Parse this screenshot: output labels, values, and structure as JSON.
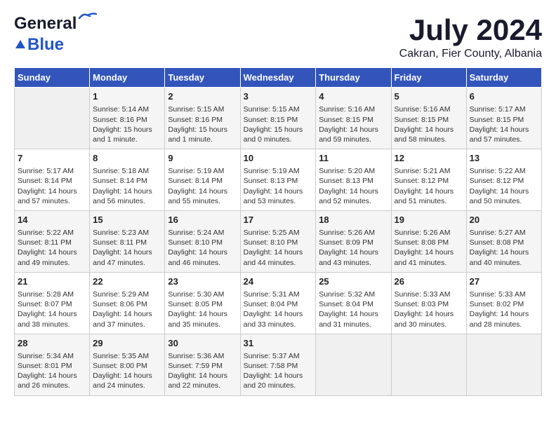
{
  "header": {
    "logo_line1": "General",
    "logo_line2": "Blue",
    "month": "July 2024",
    "location": "Cakran, Fier County, Albania"
  },
  "days_of_week": [
    "Sunday",
    "Monday",
    "Tuesday",
    "Wednesday",
    "Thursday",
    "Friday",
    "Saturday"
  ],
  "weeks": [
    [
      {
        "day": "",
        "content": ""
      },
      {
        "day": "1",
        "content": "Sunrise: 5:14 AM\nSunset: 8:16 PM\nDaylight: 15 hours\nand 1 minute."
      },
      {
        "day": "2",
        "content": "Sunrise: 5:15 AM\nSunset: 8:16 PM\nDaylight: 15 hours\nand 1 minute."
      },
      {
        "day": "3",
        "content": "Sunrise: 5:15 AM\nSunset: 8:15 PM\nDaylight: 15 hours\nand 0 minutes."
      },
      {
        "day": "4",
        "content": "Sunrise: 5:16 AM\nSunset: 8:15 PM\nDaylight: 14 hours\nand 59 minutes."
      },
      {
        "day": "5",
        "content": "Sunrise: 5:16 AM\nSunset: 8:15 PM\nDaylight: 14 hours\nand 58 minutes."
      },
      {
        "day": "6",
        "content": "Sunrise: 5:17 AM\nSunset: 8:15 PM\nDaylight: 14 hours\nand 57 minutes."
      }
    ],
    [
      {
        "day": "7",
        "content": "Sunrise: 5:17 AM\nSunset: 8:14 PM\nDaylight: 14 hours\nand 57 minutes."
      },
      {
        "day": "8",
        "content": "Sunrise: 5:18 AM\nSunset: 8:14 PM\nDaylight: 14 hours\nand 56 minutes."
      },
      {
        "day": "9",
        "content": "Sunrise: 5:19 AM\nSunset: 8:14 PM\nDaylight: 14 hours\nand 55 minutes."
      },
      {
        "day": "10",
        "content": "Sunrise: 5:19 AM\nSunset: 8:13 PM\nDaylight: 14 hours\nand 53 minutes."
      },
      {
        "day": "11",
        "content": "Sunrise: 5:20 AM\nSunset: 8:13 PM\nDaylight: 14 hours\nand 52 minutes."
      },
      {
        "day": "12",
        "content": "Sunrise: 5:21 AM\nSunset: 8:12 PM\nDaylight: 14 hours\nand 51 minutes."
      },
      {
        "day": "13",
        "content": "Sunrise: 5:22 AM\nSunset: 8:12 PM\nDaylight: 14 hours\nand 50 minutes."
      }
    ],
    [
      {
        "day": "14",
        "content": "Sunrise: 5:22 AM\nSunset: 8:11 PM\nDaylight: 14 hours\nand 49 minutes."
      },
      {
        "day": "15",
        "content": "Sunrise: 5:23 AM\nSunset: 8:11 PM\nDaylight: 14 hours\nand 47 minutes."
      },
      {
        "day": "16",
        "content": "Sunrise: 5:24 AM\nSunset: 8:10 PM\nDaylight: 14 hours\nand 46 minutes."
      },
      {
        "day": "17",
        "content": "Sunrise: 5:25 AM\nSunset: 8:10 PM\nDaylight: 14 hours\nand 44 minutes."
      },
      {
        "day": "18",
        "content": "Sunrise: 5:26 AM\nSunset: 8:09 PM\nDaylight: 14 hours\nand 43 minutes."
      },
      {
        "day": "19",
        "content": "Sunrise: 5:26 AM\nSunset: 8:08 PM\nDaylight: 14 hours\nand 41 minutes."
      },
      {
        "day": "20",
        "content": "Sunrise: 5:27 AM\nSunset: 8:08 PM\nDaylight: 14 hours\nand 40 minutes."
      }
    ],
    [
      {
        "day": "21",
        "content": "Sunrise: 5:28 AM\nSunset: 8:07 PM\nDaylight: 14 hours\nand 38 minutes."
      },
      {
        "day": "22",
        "content": "Sunrise: 5:29 AM\nSunset: 8:06 PM\nDaylight: 14 hours\nand 37 minutes."
      },
      {
        "day": "23",
        "content": "Sunrise: 5:30 AM\nSunset: 8:05 PM\nDaylight: 14 hours\nand 35 minutes."
      },
      {
        "day": "24",
        "content": "Sunrise: 5:31 AM\nSunset: 8:04 PM\nDaylight: 14 hours\nand 33 minutes."
      },
      {
        "day": "25",
        "content": "Sunrise: 5:32 AM\nSunset: 8:04 PM\nDaylight: 14 hours\nand 31 minutes."
      },
      {
        "day": "26",
        "content": "Sunrise: 5:33 AM\nSunset: 8:03 PM\nDaylight: 14 hours\nand 30 minutes."
      },
      {
        "day": "27",
        "content": "Sunrise: 5:33 AM\nSunset: 8:02 PM\nDaylight: 14 hours\nand 28 minutes."
      }
    ],
    [
      {
        "day": "28",
        "content": "Sunrise: 5:34 AM\nSunset: 8:01 PM\nDaylight: 14 hours\nand 26 minutes."
      },
      {
        "day": "29",
        "content": "Sunrise: 5:35 AM\nSunset: 8:00 PM\nDaylight: 14 hours\nand 24 minutes."
      },
      {
        "day": "30",
        "content": "Sunrise: 5:36 AM\nSunset: 7:59 PM\nDaylight: 14 hours\nand 22 minutes."
      },
      {
        "day": "31",
        "content": "Sunrise: 5:37 AM\nSunset: 7:58 PM\nDaylight: 14 hours\nand 20 minutes."
      },
      {
        "day": "",
        "content": ""
      },
      {
        "day": "",
        "content": ""
      },
      {
        "day": "",
        "content": ""
      }
    ]
  ]
}
